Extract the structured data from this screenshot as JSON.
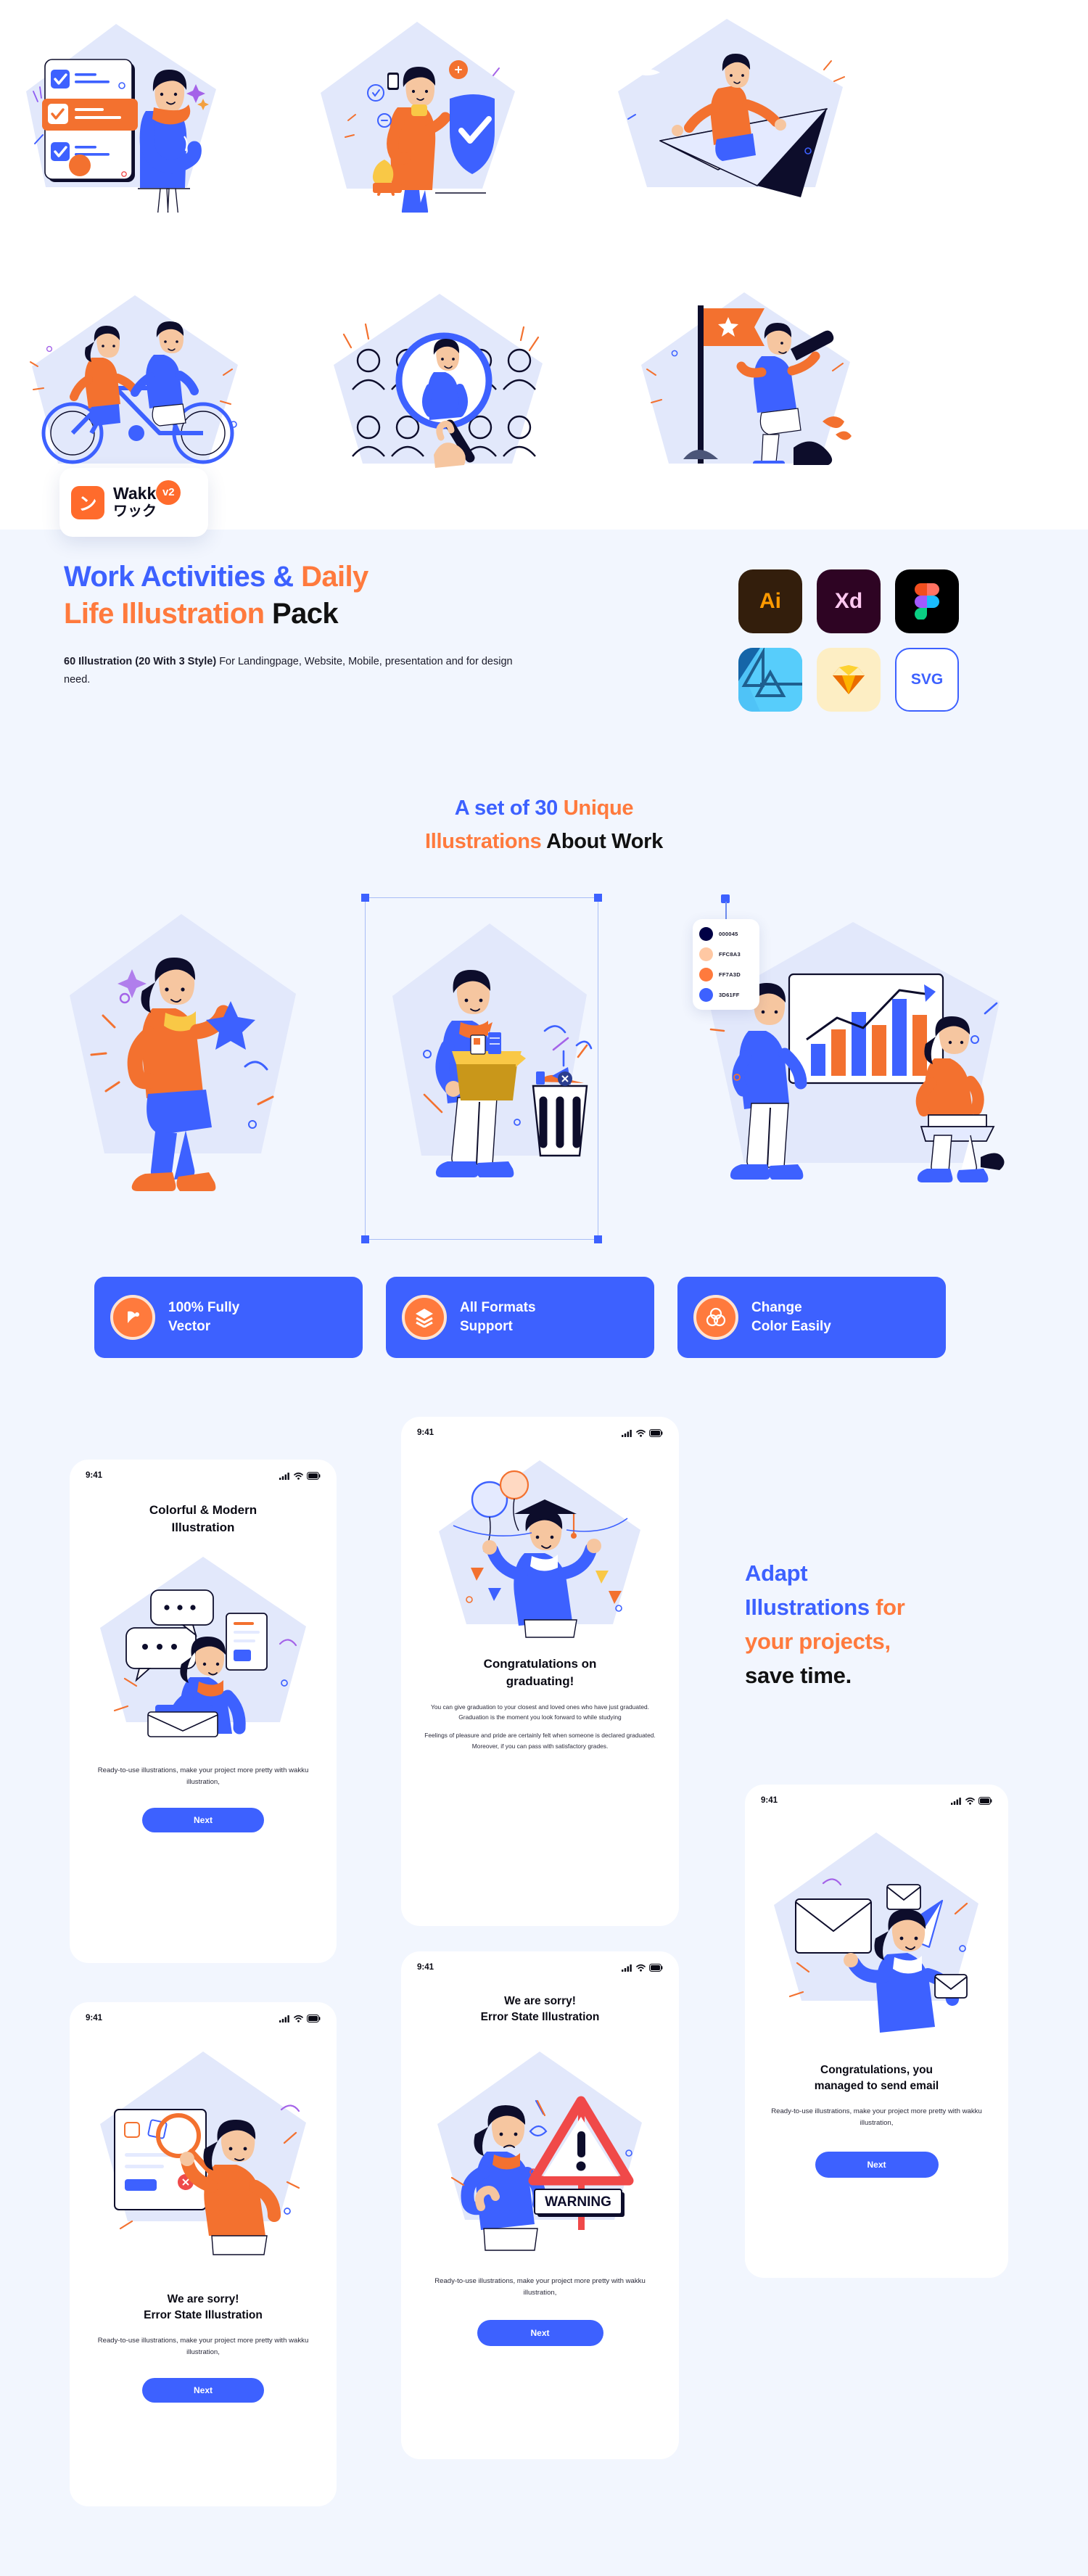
{
  "brand": {
    "name": "Wakku",
    "name_jp": "ワック",
    "version_badge": "v2",
    "logo_glyph": "ン"
  },
  "hero": {
    "title_line1_blue": "Work Activities &",
    "title_line1_orange": " Daily",
    "title_line2_orange": "Life Illustration",
    "title_line2_black": " Pack",
    "subtitle_bold": "60 Illustration (20 With 3 Style)",
    "subtitle_rest": " For Landingpage, Website, Mobile, presentation and for design need."
  },
  "formats": [
    {
      "id": "illustrator",
      "label": "Ai",
      "icon": "adobe-illustrator-icon"
    },
    {
      "id": "xd",
      "label": "Xd",
      "icon": "adobe-xd-icon"
    },
    {
      "id": "figma",
      "label": "",
      "icon": "figma-icon"
    },
    {
      "id": "affinity",
      "label": "",
      "icon": "affinity-designer-icon"
    },
    {
      "id": "sketch",
      "label": "",
      "icon": "sketch-icon"
    },
    {
      "id": "svg",
      "label": "SVG",
      "icon": "svg-icon"
    }
  ],
  "section": {
    "line1_blue": "A set of 30 ",
    "line1_orange": "Unique",
    "line2_orange": "Illustrations",
    "line2_black": " About Work"
  },
  "palette": {
    "title": "color-swatches",
    "colors": [
      {
        "hex": "000045",
        "css": "#000045"
      },
      {
        "hex": "FFC8A3",
        "css": "#FFC8A3"
      },
      {
        "hex": "FF7A3D",
        "css": "#FF7A3D"
      },
      {
        "hex": "3D61FF",
        "css": "#3D61FF"
      }
    ]
  },
  "features": [
    {
      "icon": "vector-pen-icon",
      "line1": "100% Fully",
      "line2": "Vector"
    },
    {
      "icon": "layers-stack-icon",
      "line1": "All Formats",
      "line2": "Support"
    },
    {
      "icon": "color-circles-icon",
      "line1": "Change",
      "line2": "Color Easily"
    }
  ],
  "phones": {
    "colorful": {
      "time": "9:41",
      "title_line1": "Colorful & Modern",
      "title_line2": "Illustration",
      "body": "Ready-to-use illustrations, make your project more pretty with wakku illustration,",
      "next": "Next"
    },
    "graduation": {
      "time": "9:41",
      "title_line1": "Congratulations on",
      "title_line2": "graduating!",
      "body_p1": "You can give graduation to your closest and loved ones who have just graduated. Graduation is the moment you look forward to while studying",
      "body_p2": "Feelings of pleasure and pride are certainly felt when someone is declared graduated. Moreover, if you can pass with satisfactory grades."
    },
    "email": {
      "time": "9:41",
      "title_line1": "Congratulations, you",
      "title_line2": "managed to send email",
      "body": "Ready-to-use illustrations, make your project more pretty with wakku illustration,",
      "next": "Next"
    },
    "error_left": {
      "time": "9:41",
      "title_line1": "We are sorry!",
      "title_line2": "Error State Illustration",
      "body": "Ready-to-use illustrations, make your project more pretty with wakku illustration,",
      "next": "Next"
    },
    "error_mid": {
      "time": "9:41",
      "title_line1": "We are sorry!",
      "title_line2": "Error State Illustration",
      "warning_sign": "WARNING",
      "body": "Ready-to-use illustrations, make your project more pretty with wakku illustration,",
      "next": "Next"
    }
  },
  "adapt": {
    "line1_blue": "Adapt",
    "line2_blue": "Illustrations",
    "line2_orange": " for",
    "line3_orange": "your projects,",
    "line4_black": "save time."
  },
  "colors": {
    "brand_blue": "#3D61FF",
    "brand_orange": "#FF7A3D",
    "navy": "#000045",
    "peach": "#FFC8A3",
    "page_bg": "#F2F6FE"
  }
}
